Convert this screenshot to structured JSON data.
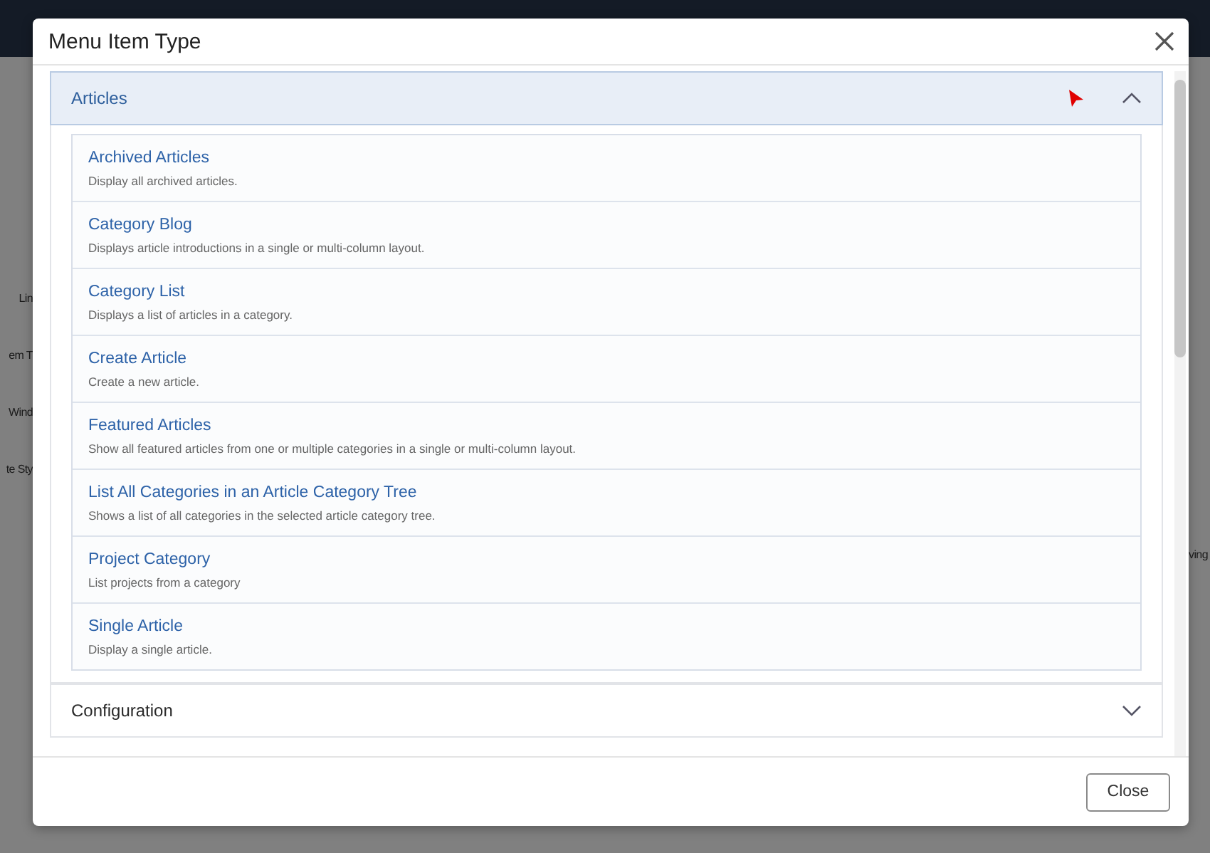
{
  "background": {
    "left_labels": [
      "Lin",
      "em T",
      "Wind",
      "te Sty"
    ],
    "right_labels": [
      "ving"
    ]
  },
  "modal": {
    "title": "Menu Item Type",
    "sections": [
      {
        "title": "Articles",
        "expanded": true,
        "items": [
          {
            "title": "Archived Articles",
            "description": "Display all archived articles."
          },
          {
            "title": "Category Blog",
            "description": "Displays article introductions in a single or multi-column layout."
          },
          {
            "title": "Category List",
            "description": "Displays a list of articles in a category."
          },
          {
            "title": "Create Article",
            "description": "Create a new article."
          },
          {
            "title": "Featured Articles",
            "description": "Show all featured articles from one or multiple categories in a single or multi-column layout."
          },
          {
            "title": "List All Categories in an Article Category Tree",
            "description": "Shows a list of all categories in the selected article category tree."
          },
          {
            "title": "Project Category",
            "description": "List projects from a category"
          },
          {
            "title": "Single Article",
            "description": "Display a single article."
          }
        ]
      },
      {
        "title": "Configuration",
        "expanded": false
      }
    ],
    "buttons": [
      "Close"
    ]
  }
}
